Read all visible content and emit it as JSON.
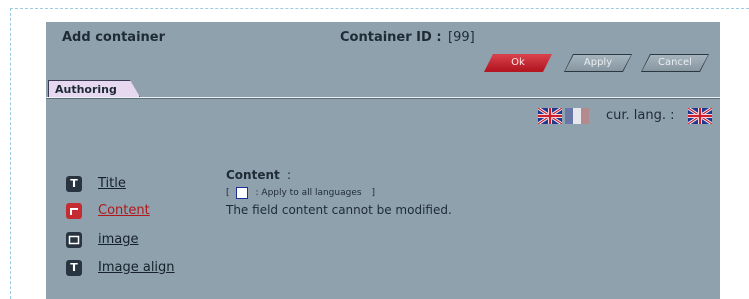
{
  "header": {
    "title": "Add container",
    "container_id_label": "Container ID :",
    "container_id_value": "[99]"
  },
  "buttons": {
    "ok": "Ok",
    "apply": "Apply",
    "cancel": "Cancel"
  },
  "tabs": [
    {
      "label": "Authoring"
    }
  ],
  "languages": {
    "flags": [
      "uk-flag",
      "fr-flag"
    ],
    "current_label": "cur. lang. :",
    "current_flag": "uk-flag"
  },
  "fields": [
    {
      "label": "Title",
      "icon": "text-field-icon",
      "icon_glyph": "T",
      "active": false
    },
    {
      "label": "Content",
      "icon": "content-field-icon",
      "icon_glyph": "",
      "active": true
    },
    {
      "label": "image",
      "icon": "image-field-icon",
      "icon_glyph": "",
      "active": false
    },
    {
      "label": "Image align",
      "icon": "text-field-icon",
      "icon_glyph": "T",
      "active": false
    }
  ],
  "content_panel": {
    "title": "Content",
    "colon": ":",
    "apply_open": "[",
    "apply_label": ": Apply to all languages",
    "apply_close": "]",
    "info": "The field content cannot be modified."
  },
  "colors": {
    "panel_bg": "#8fa1ad",
    "ok_button": "#c8222b",
    "active_link": "#b1181c"
  }
}
